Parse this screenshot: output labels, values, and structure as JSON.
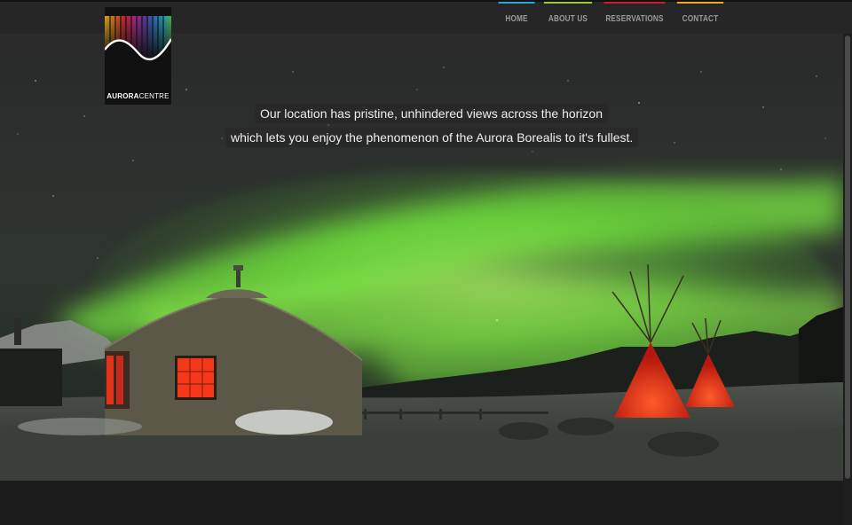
{
  "nav": {
    "items": [
      {
        "label": "HOME",
        "color": "#2aa7d6"
      },
      {
        "label": "ABOUT US",
        "color": "#9fc53a"
      },
      {
        "label": "RESERVATIONS",
        "color": "#d0192f"
      },
      {
        "label": "CONTACT",
        "color": "#f0a71e"
      }
    ]
  },
  "logo": {
    "brand_bold": "AURORA",
    "brand_light": "CENTRE"
  },
  "hero": {
    "caption_line1": "Our location has pristine, unhindered views across the horizon",
    "caption_line2": "which lets you enjoy the phenomenon of the Aurora Borealis to it's fullest.",
    "accent_colors": {
      "aurora": "#7df542",
      "tipi_glow": "#ff3a1a"
    }
  }
}
